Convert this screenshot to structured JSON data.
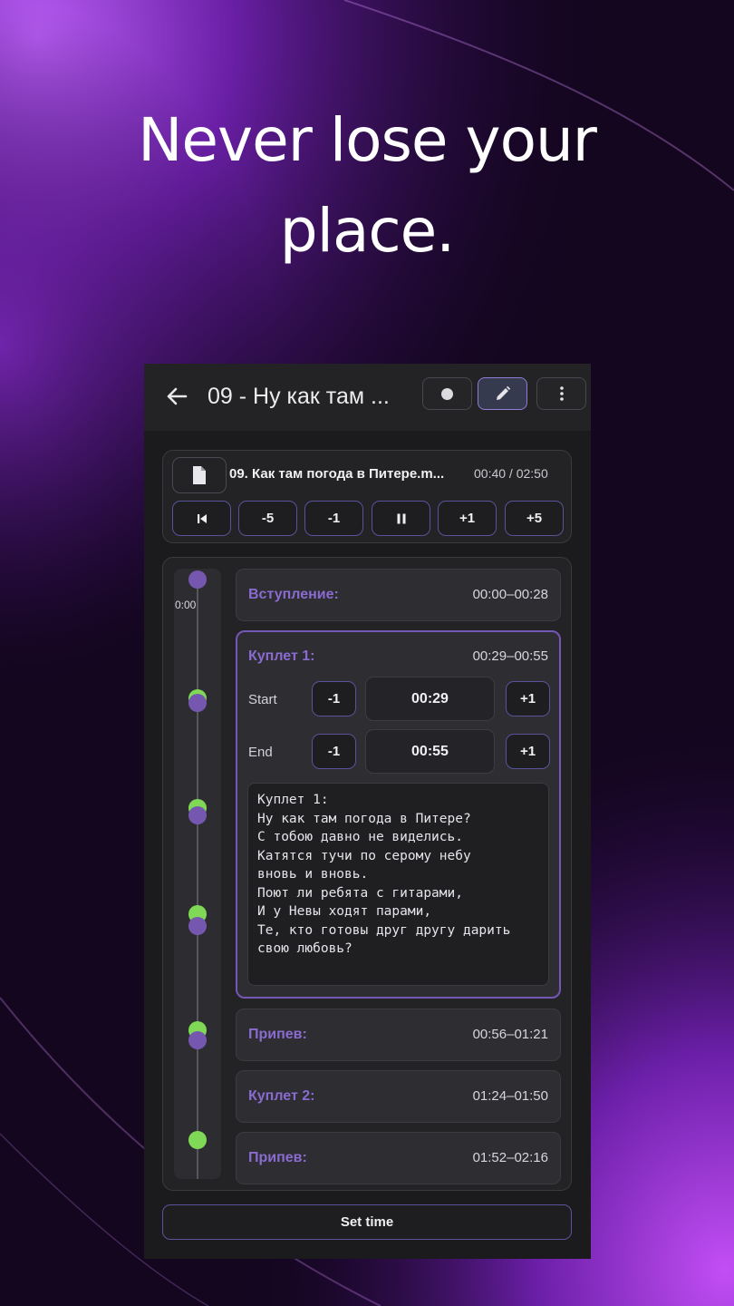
{
  "headline": {
    "line1": "Never lose your",
    "line2": "place."
  },
  "appbar": {
    "title": "09 - Ну как там ..."
  },
  "player": {
    "file_name": "09. Как там погода в Питере.m...",
    "time_display": "00:40 / 02:50",
    "controls": [
      "-5",
      "-1",
      "+1",
      "+5"
    ]
  },
  "timeline": {
    "start_label": "0:00"
  },
  "sections": [
    {
      "name": "Вступление:",
      "range": "00:00–00:28"
    },
    {
      "name": "Куплет 1:",
      "range": "00:29–00:55"
    },
    {
      "name": "Припев:",
      "range": "00:56–01:21"
    },
    {
      "name": "Куплет 2:",
      "range": "01:24–01:50"
    },
    {
      "name": "Припев:",
      "range": "01:52–02:16"
    }
  ],
  "editor": {
    "start_label": "Start",
    "end_label": "End",
    "minus": "-1",
    "plus": "+1",
    "start_value": "00:29",
    "end_value": "00:55",
    "lyrics": "Куплет 1:\nНу как там погода в Питере?\nС тобою давно не виделись.\nКатятся тучи по серому небу\nвновь и вновь.\nПоют ли ребята с гитарами,\nИ у Невы ходят парами,\nТе, кто готовы друг другу дарить\nсвою любовь?"
  },
  "set_time_label": "Set time",
  "colors": {
    "accent": "#7457b5",
    "marker_green": "#7fd957",
    "marker_purple": "#7657b0"
  }
}
